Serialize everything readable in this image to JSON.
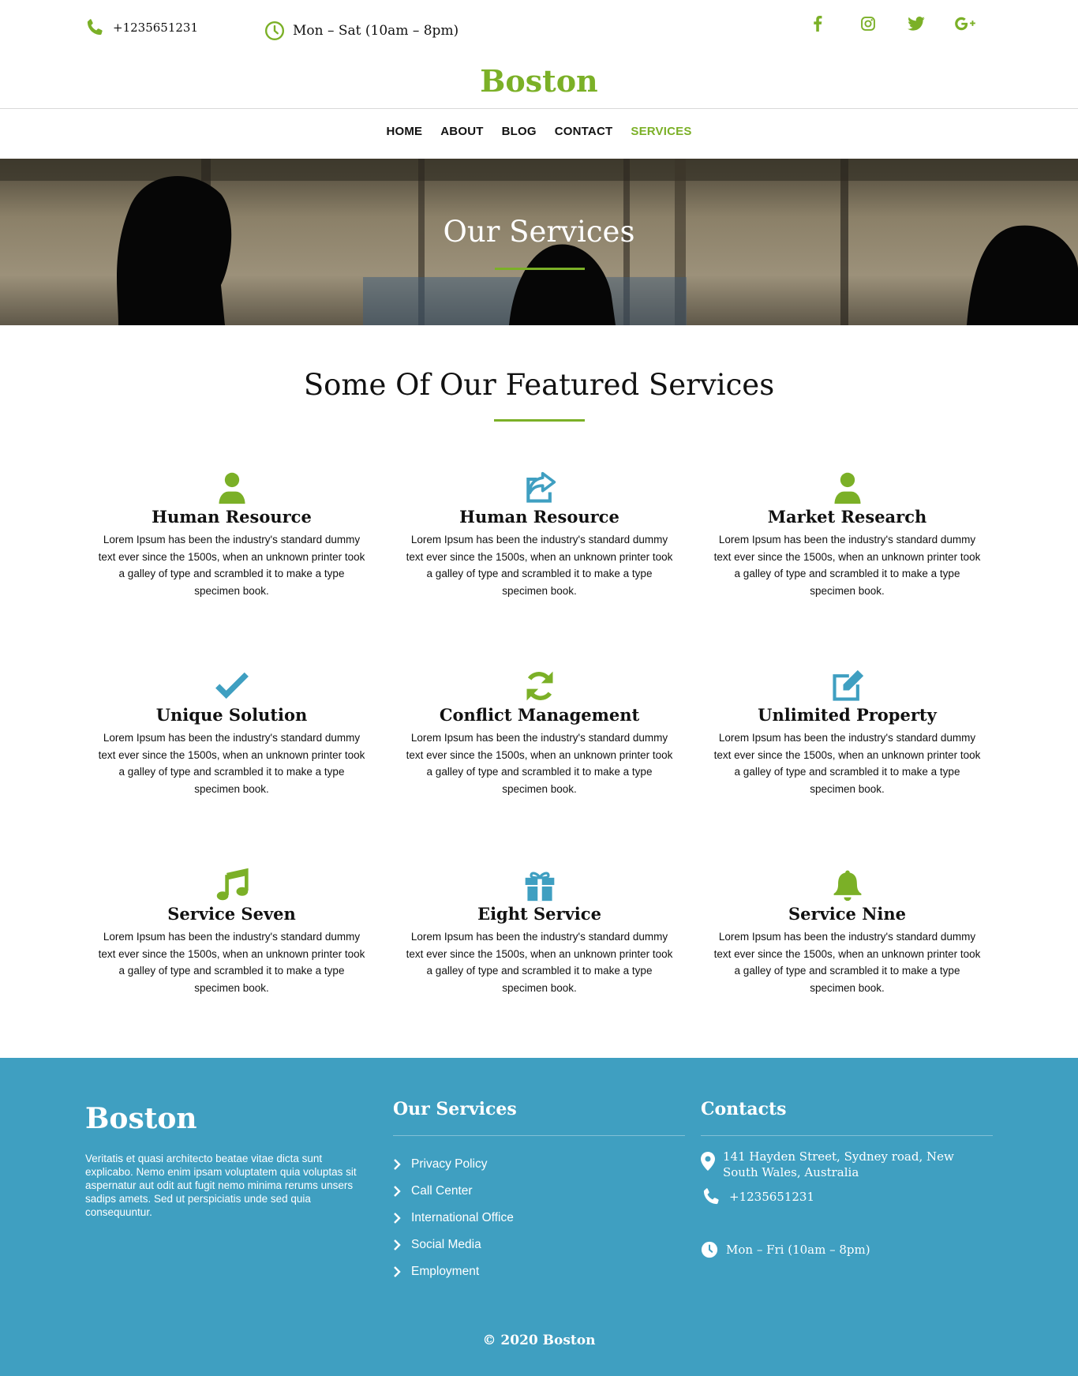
{
  "topbar": {
    "phone": "+1235651231",
    "hours": "Mon – Sat (10am – 8pm)",
    "socials": [
      "facebook-icon",
      "instagram-icon",
      "twitter-icon",
      "google-plus-icon"
    ],
    "social_glyphs": [
      "f",
      "◎",
      "🐦",
      "G+"
    ]
  },
  "header": {
    "logo": "Boston"
  },
  "nav": {
    "items": [
      "HOME",
      "ABOUT",
      "BLOG",
      "CONTACT",
      "SERVICES"
    ],
    "active": "SERVICES"
  },
  "hero": {
    "title": "Our Services"
  },
  "featured": {
    "title": "Some Of Our Featured Services",
    "services": [
      {
        "title": "Human Resource",
        "icon": "user-icon",
        "color": "#7bb027",
        "text": "Lorem Ipsum has been the industry's standard dummy text ever since the 1500s, when an unknown printer took a galley of type and scrambled it to make a type specimen book."
      },
      {
        "title": "Human Resource",
        "icon": "share-icon",
        "color": "#3f9fc1",
        "text": "Lorem Ipsum has been the industry's standard dummy text ever since the 1500s, when an unknown printer took a galley of type and scrambled it to make a type specimen book."
      },
      {
        "title": "Market Research",
        "icon": "user-icon",
        "color": "#7bb027",
        "text": "Lorem Ipsum has been the industry's standard dummy text ever since the 1500s, when an unknown printer took a galley of type and scrambled it to make a type specimen book."
      },
      {
        "title": "Unique Solution",
        "icon": "check-icon",
        "color": "#3f9fc1",
        "text": "Lorem Ipsum has been the industry's standard dummy text ever since the 1500s, when an unknown printer took a galley of type and scrambled it to make a type specimen book."
      },
      {
        "title": "Conflict Management",
        "icon": "refresh-icon",
        "color": "#7bb027",
        "text": "Lorem Ipsum has been the industry's standard dummy text ever since the 1500s, when an unknown printer took a galley of type and scrambled it to make a type specimen book."
      },
      {
        "title": "Unlimited Property",
        "icon": "edit-icon",
        "color": "#3f9fc1",
        "text": "Lorem Ipsum has been the industry's standard dummy text ever since the 1500s, when an unknown printer took a galley of type and scrambled it to make a type specimen book."
      },
      {
        "title": "Service Seven",
        "icon": "music-icon",
        "color": "#7bb027",
        "text": "Lorem Ipsum has been the industry's standard dummy text ever since the 1500s, when an unknown printer took a galley of type and scrambled it to make a type specimen book."
      },
      {
        "title": "Eight Service",
        "icon": "gift-icon",
        "color": "#3f9fc1",
        "text": "Lorem Ipsum has been the industry's standard dummy text ever since the 1500s, when an unknown printer took a galley of type and scrambled it to make a type specimen book."
      },
      {
        "title": "Service Nine",
        "icon": "bell-icon",
        "color": "#7bb027",
        "text": "Lorem Ipsum has been the industry's standard dummy text ever since the 1500s, when an unknown printer took a galley of type and scrambled it to make a type specimen book."
      }
    ]
  },
  "footer": {
    "logo": "Boston",
    "description": "Veritatis et quasi architecto beatae vitae dicta sunt explicabo. Nemo enim ipsam voluptatem quia voluptas sit aspernatur aut odit aut fugit nemo minima rerums unsers sadips amets. Sed ut perspiciatis unde sed quia consequuntur.",
    "services_heading": "Our Services",
    "services_links": [
      "Privacy Policy",
      "Call Center",
      "International Office",
      "Social Media",
      "Employment"
    ],
    "contacts_heading": "Contacts",
    "address": "141 Hayden Street, Sydney road, New South Wales, Australia",
    "phone": "+1235651231",
    "hours": "Mon – Fri (10am – 8pm)",
    "copyright": "© 2020 Boston"
  },
  "colors": {
    "accent_green": "#7bb027",
    "accent_blue": "#3f9fc1"
  }
}
